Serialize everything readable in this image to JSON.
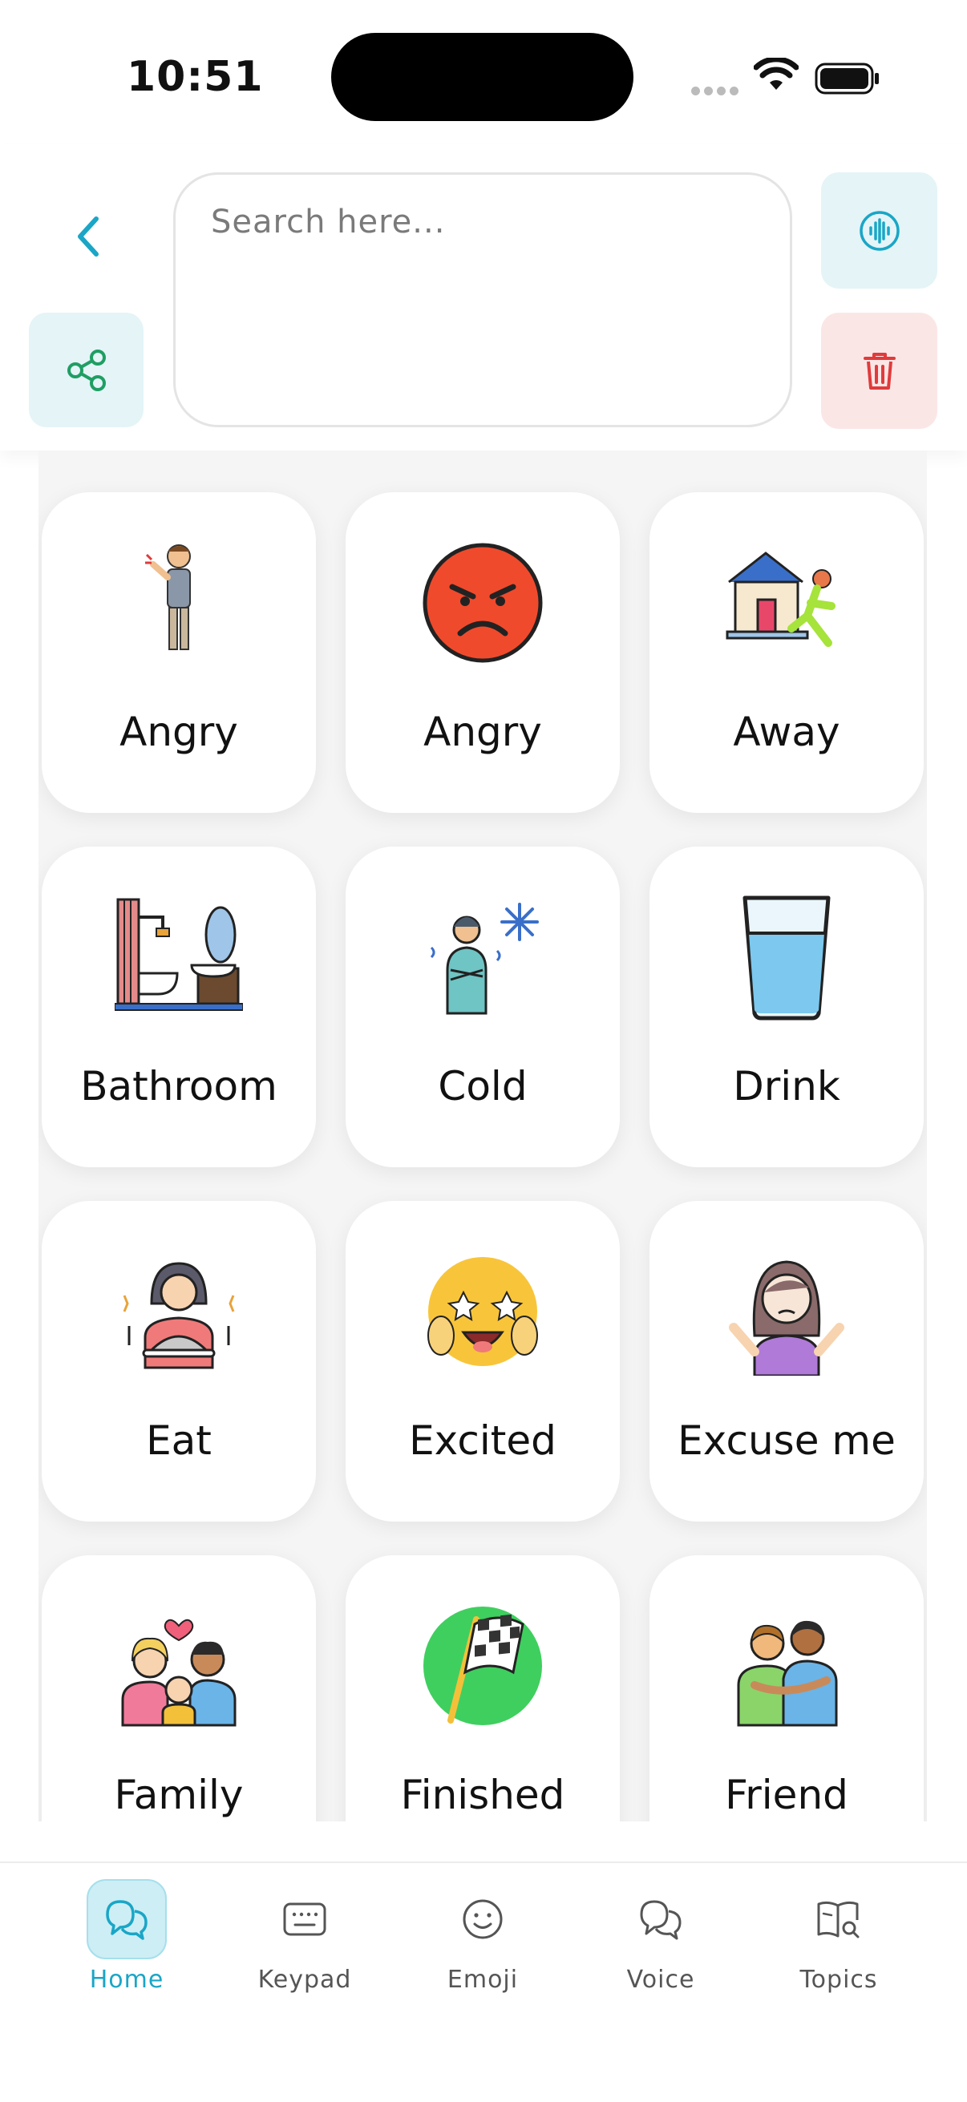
{
  "status_bar": {
    "time": "10:51"
  },
  "header": {
    "search_placeholder": "Search here...",
    "back_icon": "chevron-left-icon",
    "share_icon": "share-icon",
    "voice_icon": "voice-wave-icon",
    "delete_icon": "trash-icon"
  },
  "tiles": [
    {
      "label": "Angry",
      "icon": "angry-person-icon"
    },
    {
      "label": "Angry",
      "icon": "angry-face-icon"
    },
    {
      "label": "Away",
      "icon": "running-away-icon"
    },
    {
      "label": "Bathroom",
      "icon": "bathroom-icon"
    },
    {
      "label": "Cold",
      "icon": "cold-person-icon"
    },
    {
      "label": "Drink",
      "icon": "glass-of-water-icon"
    },
    {
      "label": "Eat",
      "icon": "eating-girl-icon"
    },
    {
      "label": "Excited",
      "icon": "excited-emoji-icon"
    },
    {
      "label": "Excuse me",
      "icon": "shrugging-girl-icon"
    },
    {
      "label": "Family",
      "icon": "family-icon"
    },
    {
      "label": "Finished",
      "icon": "checkered-flag-icon"
    },
    {
      "label": "Friend",
      "icon": "friends-icon"
    }
  ],
  "nav": {
    "items": [
      {
        "label": "Home",
        "icon": "chat-bubbles-icon",
        "active": true
      },
      {
        "label": "Keypad",
        "icon": "keyboard-icon",
        "active": false
      },
      {
        "label": "Emoji",
        "icon": "smiley-icon",
        "active": false
      },
      {
        "label": "Voice",
        "icon": "speech-bubbles-icon",
        "active": false
      },
      {
        "label": "Topics",
        "icon": "book-search-icon",
        "active": false
      }
    ]
  },
  "colors": {
    "accent": "#1aa6c6",
    "share_green": "#1f9e63",
    "delete_red": "#e03b3b",
    "light_teal_bg": "#e4f4f7",
    "light_red_bg": "#fbe6e6"
  }
}
